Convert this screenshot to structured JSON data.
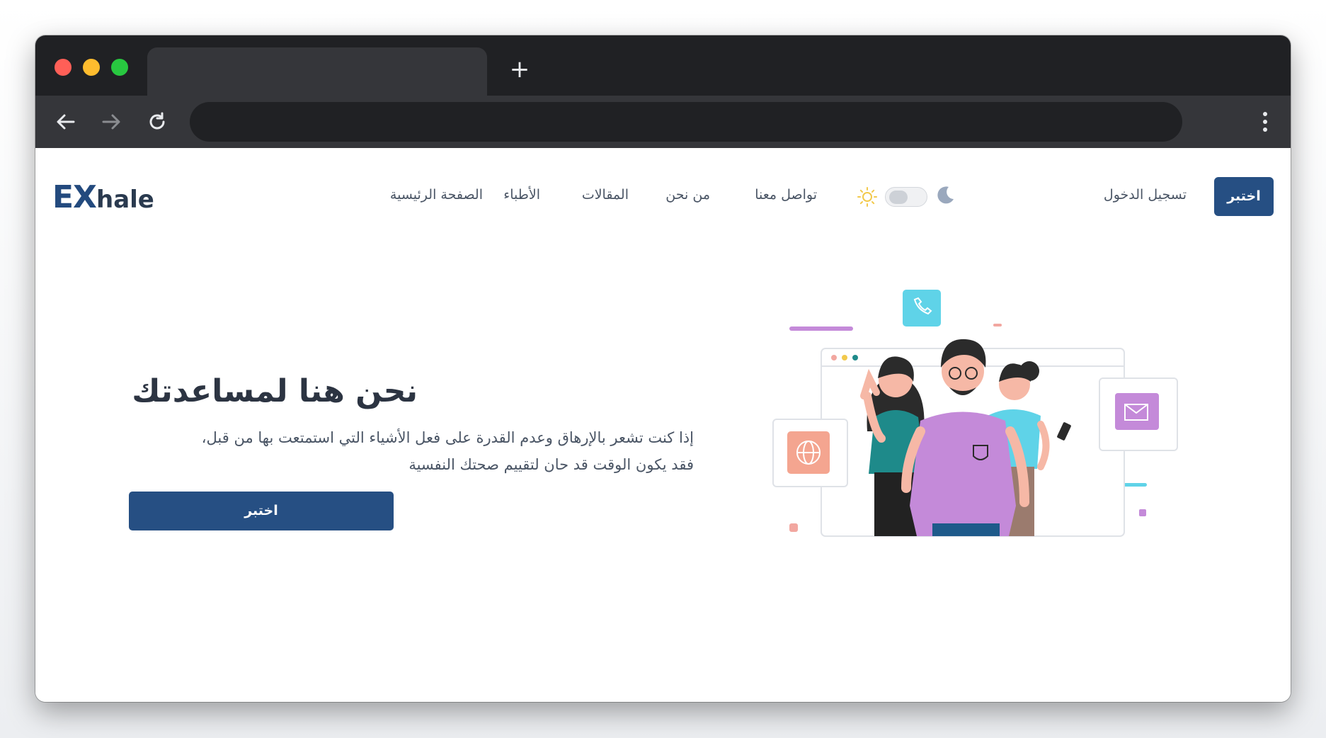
{
  "browser": {
    "new_tab_glyph": "+",
    "icons": [
      "back-arrow-icon",
      "forward-arrow-icon",
      "reload-icon",
      "more-vertical-icon"
    ]
  },
  "site": {
    "logo": {
      "part1": "EX",
      "part2": "hale"
    },
    "nav": {
      "home": "الصفحة الرئيسية",
      "doctors": "الأطباء",
      "articles": "المقالات",
      "about": "من نحن",
      "contact": "تواصل معنا"
    },
    "theme_toggle": {
      "state": "light",
      "icons": [
        "sun-icon",
        "moon-icon"
      ]
    },
    "login": "تسجيل الدخول",
    "cta": "اختبر"
  },
  "hero": {
    "title": "نحن هنا لمساعدتك",
    "description_line1": "إذا كنت تشعر بالإرهاق وعدم القدرة على فعل الأشياء التي استمتعت بها من قبل،",
    "description_line2": "فقد يكون الوقت قد حان لتقييم صحتك النفسية",
    "button": "اختبر"
  },
  "colors": {
    "brand": "#264f83",
    "chrome_dark": "#202124",
    "chrome_mid": "#35363a",
    "text": "#4a5565"
  }
}
